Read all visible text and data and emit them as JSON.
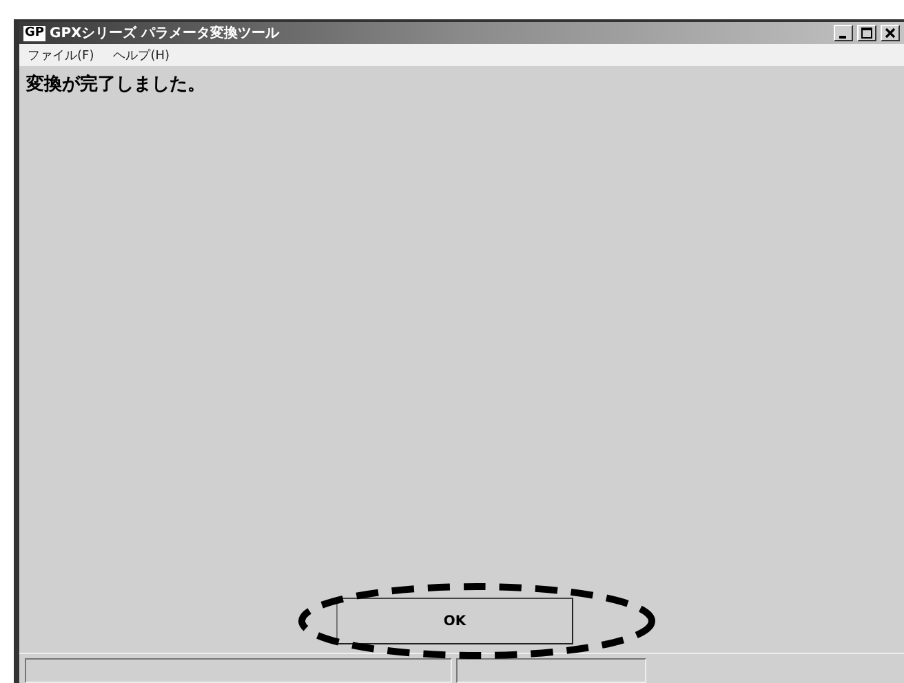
{
  "window": {
    "icon": "GP",
    "title": "GPXシリーズ パラメータ変換ツール"
  },
  "menu": [
    "ファイル(F)",
    "ヘルプ(H)"
  ],
  "message": "変換が完了しました。",
  "button": {
    "label": "OK",
    "highlighted": true
  }
}
